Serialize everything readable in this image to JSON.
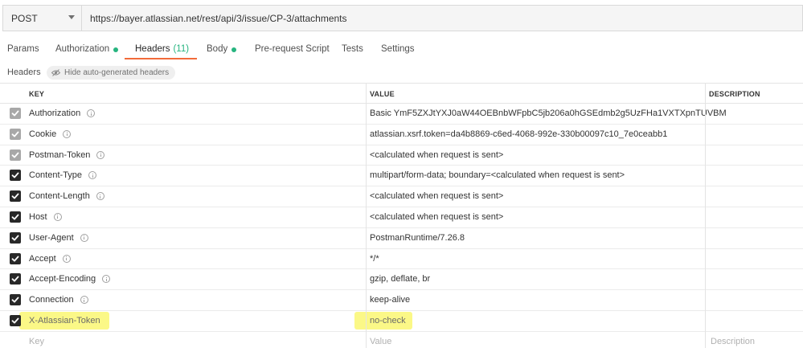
{
  "request": {
    "method": "POST",
    "url": "https://bayer.atlassian.net/rest/api/3/issue/CP-3/attachments"
  },
  "tabs": [
    {
      "label": "Params"
    },
    {
      "label": "Authorization"
    },
    {
      "label": "Headers",
      "count": "(11)"
    },
    {
      "label": "Body"
    },
    {
      "label": "Pre-request Script"
    },
    {
      "label": "Tests"
    },
    {
      "label": "Settings"
    }
  ],
  "headers_section": {
    "label": "Headers",
    "hide_button": "Hide auto-generated headers"
  },
  "table": {
    "columns": {
      "key": "KEY",
      "value": "VALUE",
      "description": "DESCRIPTION"
    },
    "rows": [
      {
        "key": "Authorization",
        "value": "Basic YmF5ZXJtYXJ0aW44OEBnbWFpbC5jb206a0hGSEdmb2g5UzFHa1VXTXpnTUVBM",
        "auto": true
      },
      {
        "key": "Cookie",
        "value": "atlassian.xsrf.token=da4b8869-c6ed-4068-992e-330b00097c10_7e0ceabb1",
        "auto": true
      },
      {
        "key": "Postman-Token",
        "value": "<calculated when request is sent>",
        "auto": true
      },
      {
        "key": "Content-Type",
        "value": "multipart/form-data; boundary=<calculated when request is sent>",
        "auto": false
      },
      {
        "key": "Content-Length",
        "value": "<calculated when request is sent>",
        "auto": false
      },
      {
        "key": "Host",
        "value": "<calculated when request is sent>",
        "auto": false
      },
      {
        "key": "User-Agent",
        "value": "PostmanRuntime/7.26.8",
        "auto": false
      },
      {
        "key": "Accept",
        "value": "*/*",
        "auto": false
      },
      {
        "key": "Accept-Encoding",
        "value": "gzip, deflate, br",
        "auto": false
      },
      {
        "key": "Connection",
        "value": "keep-alive",
        "auto": false
      },
      {
        "key": "X-Atlassian-Token",
        "value": "no-check",
        "auto": false,
        "highlighted": true
      }
    ],
    "new_row": {
      "key_placeholder": "Key",
      "value_placeholder": "Value",
      "description_placeholder": "Description"
    }
  },
  "colors": {
    "accent": "#f26b3a",
    "status_dot": "#26b47f",
    "highlight": "#fbf887"
  }
}
